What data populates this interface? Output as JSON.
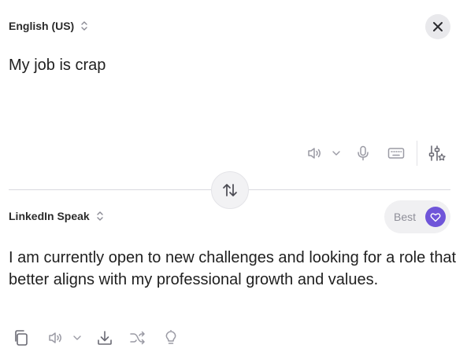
{
  "source": {
    "language": "English (US)",
    "text": "My job is crap",
    "icons": [
      "chevron-updown-icon",
      "close-icon"
    ]
  },
  "source_toolbar": {
    "icons": [
      "speaker-icon",
      "chevron-down-icon",
      "microphone-icon",
      "keyboard-icon",
      "settings-sliders-icon"
    ]
  },
  "swap": {
    "icon": "swap-arrows-icon"
  },
  "target": {
    "style": "LinkedIn Speak",
    "quality_label": "Best",
    "quality_icon": "heart-icon",
    "text": "I am currently open to new challenges and looking for a role that better aligns with my professional growth and values."
  },
  "target_toolbar": {
    "icons": [
      "copy-icon",
      "speaker-icon",
      "chevron-down-icon",
      "download-icon",
      "shuffle-icon",
      "lightbulb-icon"
    ]
  },
  "colors": {
    "accent": "#6f55d9",
    "icon": "#9a9aa4",
    "divider": "#d9d9de",
    "pill_bg": "#f0f0f2"
  }
}
